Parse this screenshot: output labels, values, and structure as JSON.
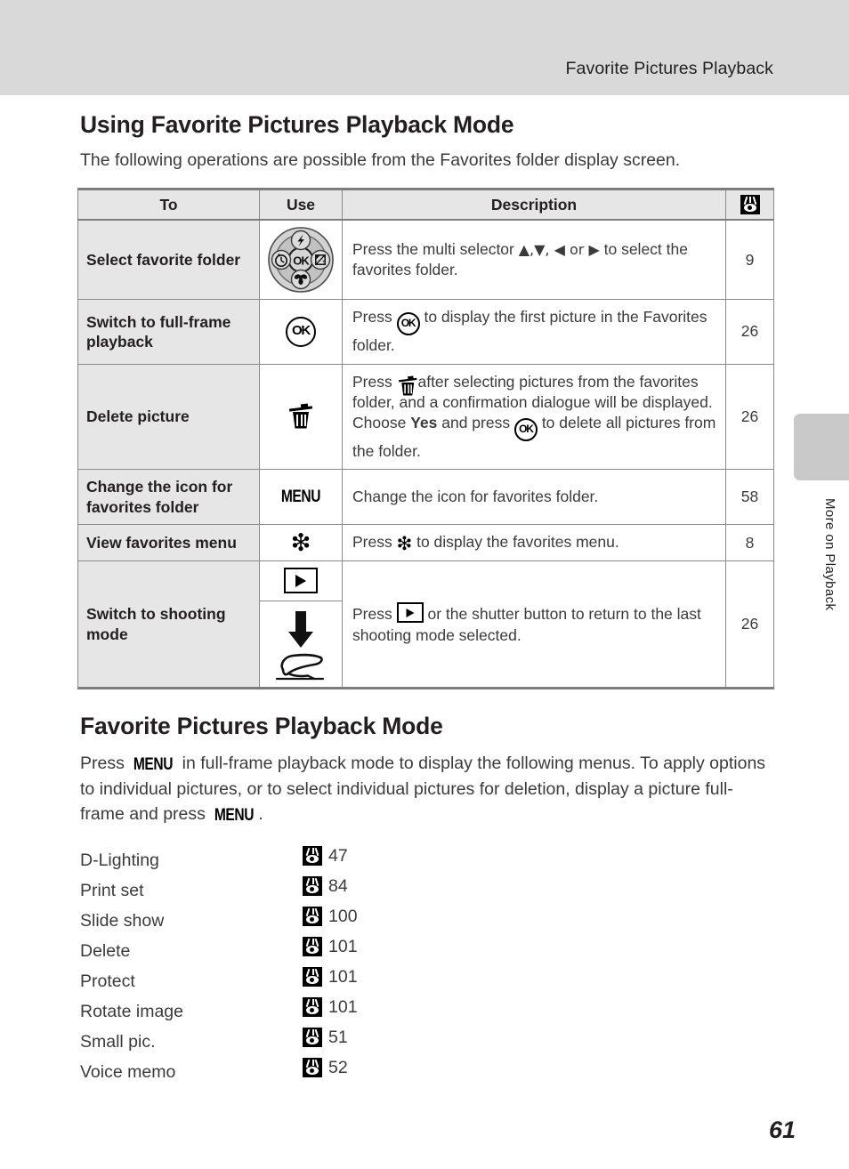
{
  "header": {
    "running_title": "Favorite Pictures Playback"
  },
  "section1": {
    "heading": "Using Favorite Pictures Playback Mode",
    "intro": "The following operations are possible from the Favorites folder display screen."
  },
  "table": {
    "columns": [
      "To",
      "Use",
      "Description",
      "reference-icon"
    ],
    "rows": [
      {
        "to": "Select favorite folder",
        "use_icon": "multi-selector-dial",
        "description_pre": "Press the multi selector ",
        "description_arrows": "▲,▼, ◀ or ▶",
        "description_post": " to select the favorites folder.",
        "ref": "9"
      },
      {
        "to": "Switch to full-frame playback",
        "use_icon": "ok-button",
        "description_pre": "Press ",
        "description_post": " to display the first picture in the Favorites folder.",
        "ref": "26"
      },
      {
        "to": "Delete picture",
        "use_icon": "trash-button",
        "description_a": "Press ",
        "description_b": " after selecting pictures from the favorites folder, and a confirmation dialogue will be displayed. Choose ",
        "description_bold": "Yes",
        "description_c": " and press ",
        "description_d": " to delete all pictures from the folder.",
        "ref": "26"
      },
      {
        "to": "Change the icon for favorites folder",
        "use_icon": "menu-button",
        "use_label": "MENU",
        "description_post": "Change the icon for favorites folder.",
        "ref": "58"
      },
      {
        "to": "View favorites menu",
        "use_icon": "favorites-flower-button",
        "description_pre": "Press ",
        "description_post": " to display the favorites menu.",
        "ref": "8"
      },
      {
        "to": "Switch to shooting mode",
        "use_icon_a": "playback-button",
        "use_icon_b": "shutter-button-press",
        "description_pre": "Press ",
        "description_post": " or the shutter button to return to the last shooting mode selected.",
        "ref": "26"
      }
    ]
  },
  "section2": {
    "heading": "Favorite Pictures Playback Mode",
    "body_a": "Press ",
    "body_menu": "MENU",
    "body_b": " in full-frame playback mode to display the following menus. To apply options to individual pictures, or to select individual pictures for deletion, display a picture full-frame and press ",
    "body_c": "."
  },
  "menu_list": [
    {
      "label": "D-Lighting",
      "page": "47"
    },
    {
      "label": "Print set",
      "page": "84"
    },
    {
      "label": "Slide show",
      "page": "100"
    },
    {
      "label": "Delete",
      "page": "101"
    },
    {
      "label": "Protect",
      "page": "101"
    },
    {
      "label": "Rotate image",
      "page": "101"
    },
    {
      "label": "Small pic.",
      "page": "51"
    },
    {
      "label": "Voice memo",
      "page": "52"
    }
  ],
  "side_tab": {
    "label": "More on Playback"
  },
  "folio": {
    "page_number": "61"
  },
  "colors": {
    "header_band": "#d9d9d9",
    "table_header_fill": "#e6e6e6",
    "table_left_fill": "#e6e6e6",
    "rule": "#7d7d7d",
    "side_tab": "#c9c9c9",
    "text": "#231f20"
  }
}
